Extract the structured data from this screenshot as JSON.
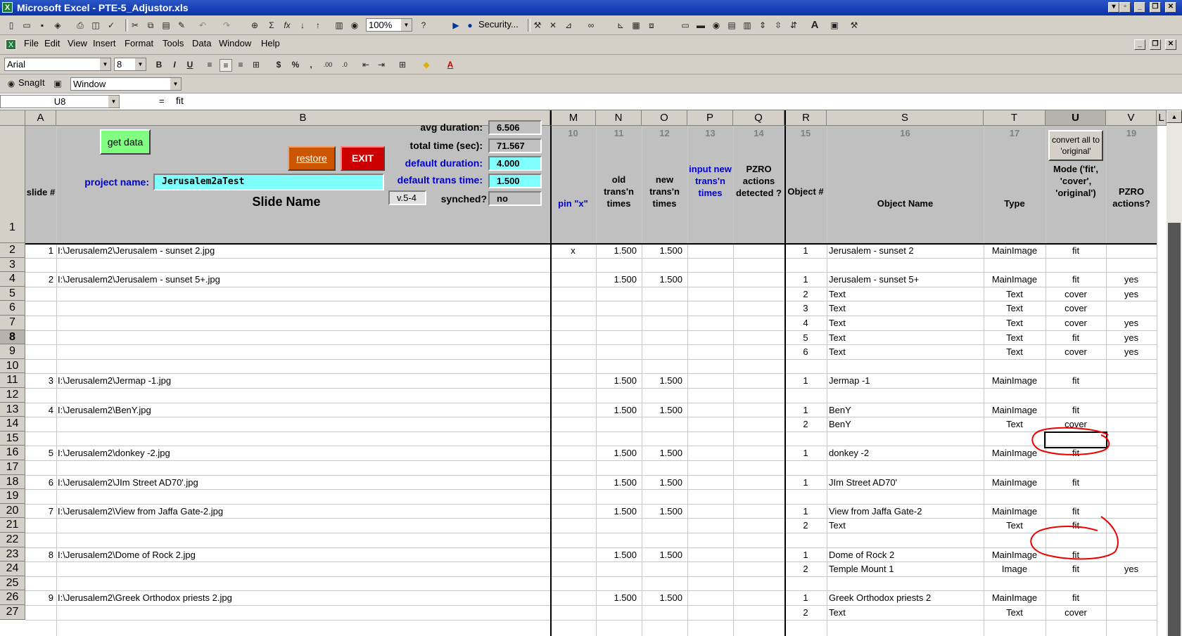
{
  "window": {
    "title": "Microsoft Excel - PTE-5_Adjustor.xls"
  },
  "menu": [
    "File",
    "Edit",
    "View",
    "Insert",
    "Format",
    "Tools",
    "Data",
    "Window",
    "Help"
  ],
  "toolbar": {
    "zoom": "100%",
    "security_label": "Security..."
  },
  "format_bar": {
    "font": "Arial",
    "size": "8"
  },
  "snagit_bar": {
    "snagit_label": "SnagIt",
    "capture_mode": "Window"
  },
  "formula_bar": {
    "name_box": "U8",
    "equals": "=",
    "formula": "fit"
  },
  "columns": [
    "A",
    "B",
    "M",
    "N",
    "O",
    "P",
    "Q",
    "R",
    "S",
    "T",
    "U",
    "V",
    "L"
  ],
  "header": {
    "get_data_label": "get data",
    "restore_label": "restore",
    "exit_label": "EXIT",
    "avg_duration_label": "avg duration:",
    "avg_duration_value": "6.506",
    "total_time_label": "total time (sec):",
    "total_time_value": "71.567",
    "default_duration_label": "default duration:",
    "default_duration_value": "4.000",
    "default_trans_label": "default trans time:",
    "default_trans_value": "1.500",
    "version": "v.5-4",
    "synched_label": "synched?",
    "synched_value": "no",
    "project_name_label": "project name:",
    "project_name_value": "Jerusalem2aTest",
    "slide_num_label": "slide #",
    "slide_name_label": "Slide Name",
    "convert_label": "convert all to 'original'",
    "col_numbers": [
      "10",
      "11",
      "12",
      "13",
      "14",
      "15",
      "16",
      "17",
      "19"
    ],
    "pin_label": "pin \"x\"",
    "old_trans": "old trans'n times",
    "new_trans": "new trans'n times",
    "input_trans": "input new trans'n times",
    "pzro_detected": "PZRO actions detected ?",
    "object_num": "Object #",
    "object_name": "Object Name",
    "type": "Type",
    "mode": "Mode ('fit', 'cover', 'original')",
    "pzro_actions": "PZRO actions?"
  },
  "row_numbers": [
    "1",
    "2",
    "3",
    "4",
    "5",
    "6",
    "7",
    "8",
    "9",
    "10",
    "11",
    "12",
    "13",
    "14",
    "15",
    "16",
    "17",
    "18",
    "19",
    "20",
    "21",
    "22",
    "23",
    "24",
    "25",
    "26",
    "27"
  ],
  "rows": [
    {
      "row": "2",
      "a": "1",
      "b": "I:\\Jerusalem2\\Jerusalem - sunset 2.jpg",
      "m": "x",
      "n": "1.500",
      "o": "1.500",
      "r": "1",
      "s": "Jerusalem - sunset 2",
      "t": "MainImage",
      "u": "fit",
      "v": ""
    },
    {
      "row": "3"
    },
    {
      "row": "4",
      "a": "2",
      "b": "I:\\Jerusalem2\\Jerusalem - sunset 5+.jpg",
      "n": "1.500",
      "o": "1.500",
      "r": "1",
      "s": "Jerusalem - sunset 5+",
      "t": "MainImage",
      "u": "fit",
      "v": "yes"
    },
    {
      "row": "5",
      "r": "2",
      "s": "Text",
      "t": "Text",
      "u": "cover",
      "v": "yes"
    },
    {
      "row": "6",
      "r": "3",
      "s": "Text",
      "t": "Text",
      "u": "cover",
      "v": ""
    },
    {
      "row": "7",
      "r": "4",
      "s": "Text",
      "t": "Text",
      "u": "cover",
      "v": "yes"
    },
    {
      "row": "8",
      "r": "5",
      "s": "Text",
      "t": "Text",
      "u": "fit",
      "v": "yes"
    },
    {
      "row": "9",
      "r": "6",
      "s": "Text",
      "t": "Text",
      "u": "cover",
      "v": "yes"
    },
    {
      "row": "10"
    },
    {
      "row": "11",
      "a": "3",
      "b": "I:\\Jerusalem2\\Jermap -1.jpg",
      "n": "1.500",
      "o": "1.500",
      "r": "1",
      "s": "Jermap -1",
      "t": "MainImage",
      "u": "fit"
    },
    {
      "row": "12"
    },
    {
      "row": "13",
      "a": "4",
      "b": "I:\\Jerusalem2\\BenY.jpg",
      "n": "1.500",
      "o": "1.500",
      "r": "1",
      "s": "BenY",
      "t": "MainImage",
      "u": "fit"
    },
    {
      "row": "14",
      "r": "2",
      "s": "BenY",
      "t": "Text",
      "u": "cover"
    },
    {
      "row": "15"
    },
    {
      "row": "16",
      "a": "5",
      "b": "I:\\Jerusalem2\\donkey -2.jpg",
      "n": "1.500",
      "o": "1.500",
      "r": "1",
      "s": "donkey -2",
      "t": "MainImage",
      "u": "fit"
    },
    {
      "row": "17"
    },
    {
      "row": "18",
      "a": "6",
      "b": "I:\\Jerusalem2\\JIm Street AD70'.jpg",
      "n": "1.500",
      "o": "1.500",
      "r": "1",
      "s": "JIm Street AD70'",
      "t": "MainImage",
      "u": "fit"
    },
    {
      "row": "19"
    },
    {
      "row": "20",
      "a": "7",
      "b": "I:\\Jerusalem2\\View from Jaffa Gate-2.jpg",
      "n": "1.500",
      "o": "1.500",
      "r": "1",
      "s": "View from Jaffa Gate-2",
      "t": "MainImage",
      "u": "fit"
    },
    {
      "row": "21",
      "r": "2",
      "s": "Text",
      "t": "Text",
      "u": "fit"
    },
    {
      "row": "22"
    },
    {
      "row": "23",
      "a": "8",
      "b": "I:\\Jerusalem2\\Dome of Rock 2.jpg",
      "n": "1.500",
      "o": "1.500",
      "r": "1",
      "s": "Dome of Rock 2",
      "t": "MainImage",
      "u": "fit"
    },
    {
      "row": "24",
      "r": "2",
      "s": "Temple Mount 1",
      "t": "Image",
      "u": "fit",
      "v": "yes"
    },
    {
      "row": "25"
    },
    {
      "row": "26",
      "a": "9",
      "b": "I:\\Jerusalem2\\Greek Orthodox priests 2.jpg",
      "n": "1.500",
      "o": "1.500",
      "r": "1",
      "s": "Greek Orthodox priests 2",
      "t": "MainImage",
      "u": "fit"
    },
    {
      "row": "27",
      "r": "2",
      "s": "Text",
      "t": "Text",
      "u": "cover"
    }
  ],
  "colors": {
    "title_bar": "#0a32a8",
    "chrome": "#d4d0c8",
    "header_fill": "#c0c0c0",
    "input_cyan": "#80ffff",
    "get_data_green": "#80ff80",
    "restore_orange": "#cc5500",
    "exit_red": "#cc0000",
    "annotation_red": "#ee0000",
    "header_blue": "#0000cc"
  }
}
